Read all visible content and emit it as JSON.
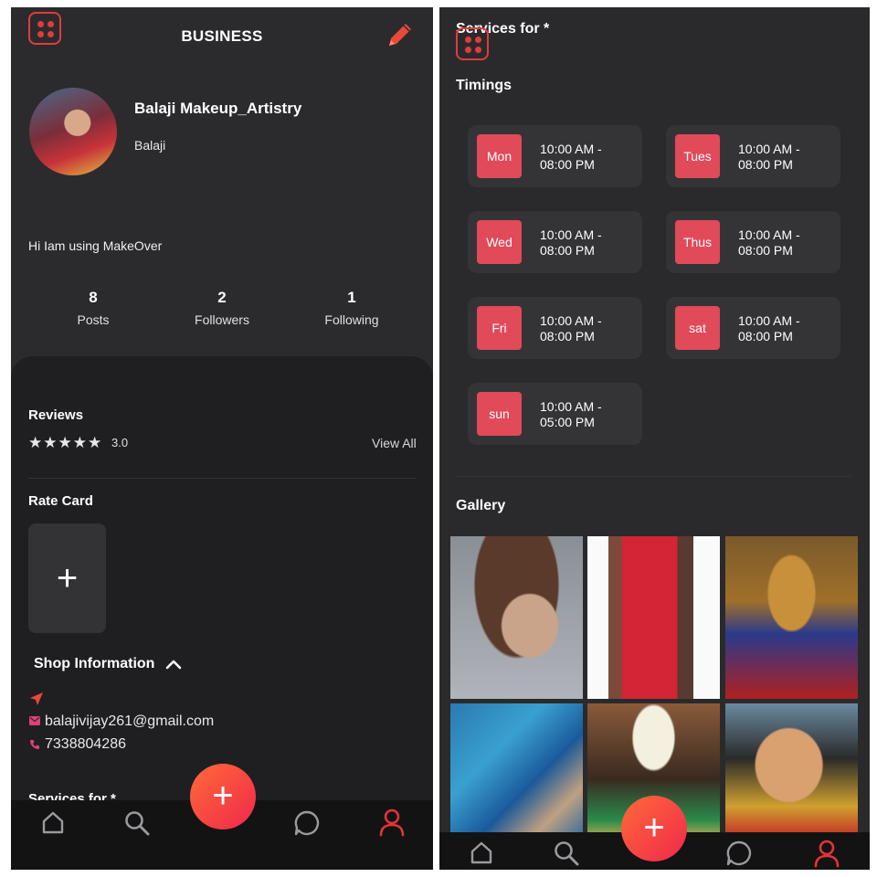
{
  "left": {
    "header": {
      "title": "BUSINESS",
      "menu_icon": "grid-menu-icon",
      "edit_icon": "pencil-icon"
    },
    "profile": {
      "name": "Balaji Makeup_Artistry",
      "username": "Balaji",
      "bio": "Hi Iam using MakeOver"
    },
    "stats": [
      {
        "value": "8",
        "label": "Posts"
      },
      {
        "value": "2",
        "label": "Followers"
      },
      {
        "value": "1",
        "label": "Following"
      }
    ],
    "reviews": {
      "title": "Reviews",
      "rating": 3.0,
      "rating_text": "3.0",
      "stars": [
        "★",
        "★",
        "★",
        "★",
        "★"
      ],
      "view_all": "View All"
    },
    "rate_card": {
      "title": "Rate Card",
      "add_symbol": "+"
    },
    "shop_info": {
      "title": "Shop Information",
      "email": "balajivijay261@gmail.com",
      "phone": "7338804286"
    },
    "services_peek": "Services for *"
  },
  "right": {
    "services_title": "Services for *",
    "timings_title": "Timings",
    "timings": [
      {
        "day": "Mon",
        "line1": "10:00 AM -",
        "line2": "08:00 PM"
      },
      {
        "day": "Tues",
        "line1": "10:00 AM -",
        "line2": "08:00 PM"
      },
      {
        "day": "Wed",
        "line1": "10:00 AM -",
        "line2": "08:00 PM"
      },
      {
        "day": "Thus",
        "line1": "10:00 AM -",
        "line2": "08:00 PM"
      },
      {
        "day": "Fri",
        "line1": "10:00 AM -",
        "line2": "08:00 PM"
      },
      {
        "day": "sat",
        "line1": "10:00 AM -",
        "line2": "08:00 PM"
      },
      {
        "day": "sun",
        "line1": "10:00 AM -",
        "line2": "05:00 PM"
      }
    ],
    "gallery_title": "Gallery"
  },
  "bottom_nav": {
    "items": [
      "home-icon",
      "search-icon",
      "chat-icon",
      "profile-icon"
    ],
    "fab_symbol": "+"
  },
  "colors": {
    "accent": "#e04a59",
    "fab_gradient_start": "#ff6a3a",
    "fab_gradient_end": "#f0284a",
    "panel_bg": "#2b2b2d",
    "nav_bg": "#131314"
  }
}
